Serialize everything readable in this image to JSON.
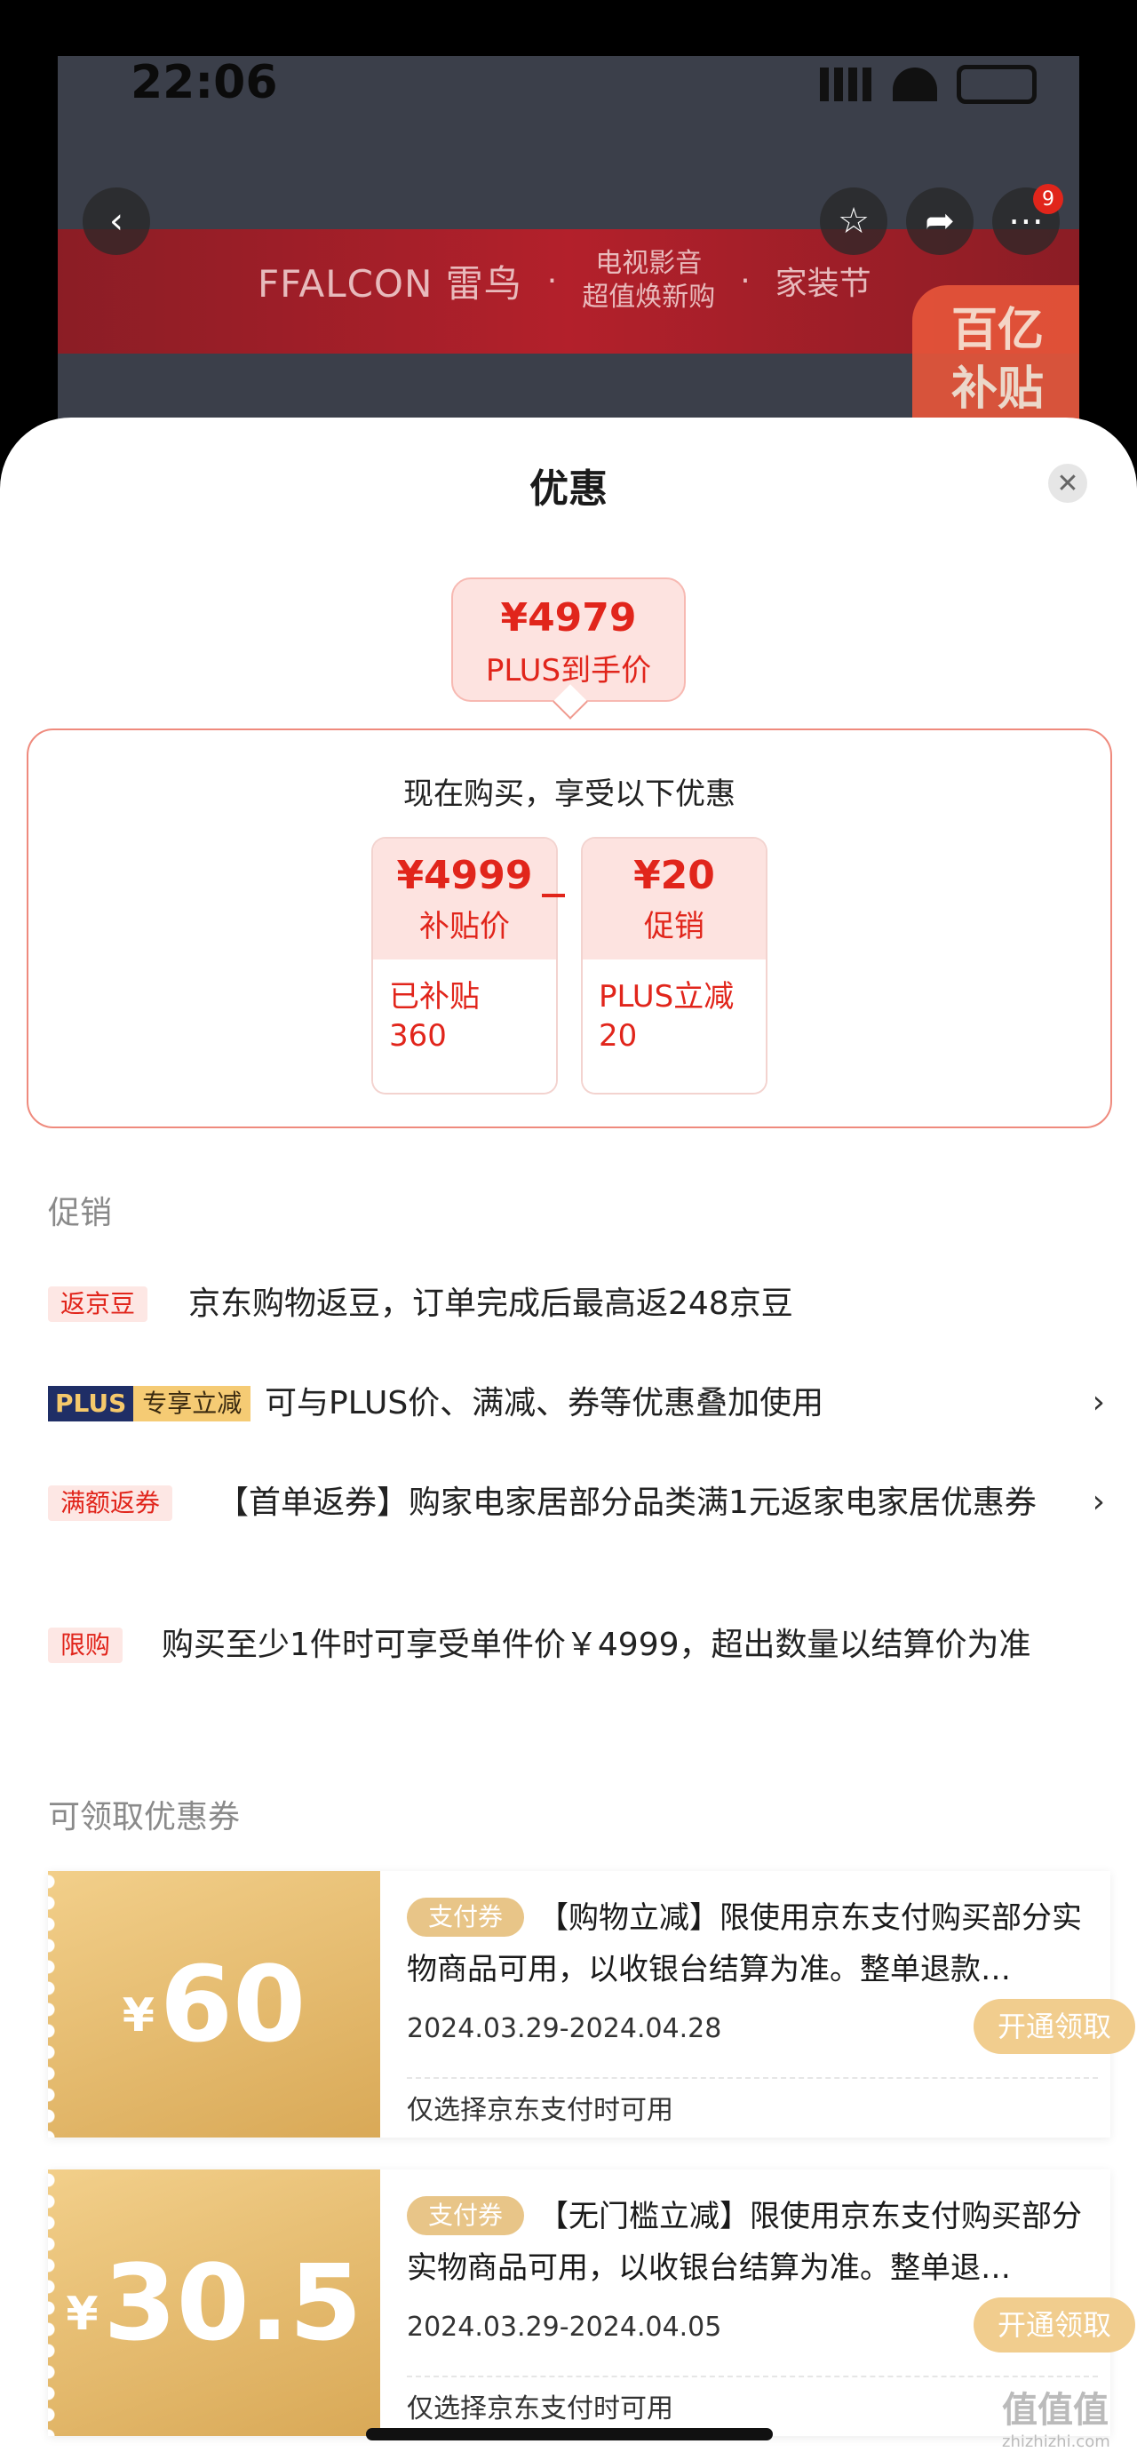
{
  "status_bar": {
    "time": "22:06"
  },
  "background_page": {
    "banner_brand": "FFALCON 雷鸟",
    "banner_line1": "电视影音",
    "banner_line2": "超值焕新购",
    "banner_event": "家装节",
    "more_badge_count": "9",
    "subsidy_tag_line1": "百亿",
    "subsidy_tag_line2": "补贴"
  },
  "sheet": {
    "title": "优惠",
    "close_icon": "close-icon",
    "final_price": {
      "amount": "¥4979",
      "label": "PLUS到手价"
    },
    "breakdown": {
      "title": "现在购买，享受以下优惠",
      "item_a": {
        "value": "¥4999",
        "label": "补贴价",
        "detail_line1": "已补贴",
        "detail_line2": "360"
      },
      "item_b": {
        "value": "¥20",
        "label": "促销",
        "detail_line1": "PLUS立减",
        "detail_line2": "20"
      }
    },
    "promotions": {
      "header": "促销",
      "items": [
        {
          "tag": "返京豆",
          "text": "京东购物返豆，订单完成后最高返248京豆",
          "has_arrow": false
        },
        {
          "tag_a": "PLUS",
          "tag_b": "专享立减",
          "text": "可与PLUS价、满减、券等优惠叠加使用",
          "has_arrow": true
        },
        {
          "tag": "满额返券",
          "text": "【首单返券】购家电家居部分品类满1元返家电家居优惠券",
          "has_arrow": true
        },
        {
          "tag": "限购",
          "text": "购买至少1件时可享受单件价￥4999，超出数量以结算价为准",
          "has_arrow": false
        }
      ],
      "arrow_glyph": "›"
    },
    "coupons": {
      "header": "可领取优惠券",
      "items": [
        {
          "currency": "¥",
          "amount": "60",
          "type_tag": "支付券",
          "description": "【购物立减】限使用京东支付购买部分实物商品可用，以收银台结算为准。整单退款…",
          "date_range": "2024.03.29-2024.04.28",
          "claim_label": "开通领取",
          "note": "仅选择京东支付时可用"
        },
        {
          "currency": "¥",
          "amount": "30.5",
          "type_tag": "支付券",
          "description": "【无门槛立减】限使用京东支付购买部分实物商品可用，以收银台结算为准。整单退…",
          "date_range": "2024.03.29-2024.04.05",
          "claim_label": "开通领取",
          "note": "仅选择京东支付时可用"
        }
      ]
    }
  },
  "watermark": {
    "main": "值值值",
    "sub": "zhizhizhi.com"
  },
  "colors": {
    "accent_red": "#e1251b",
    "coupon_gold": "#d9a957",
    "plus_navy": "#1f2e66"
  }
}
